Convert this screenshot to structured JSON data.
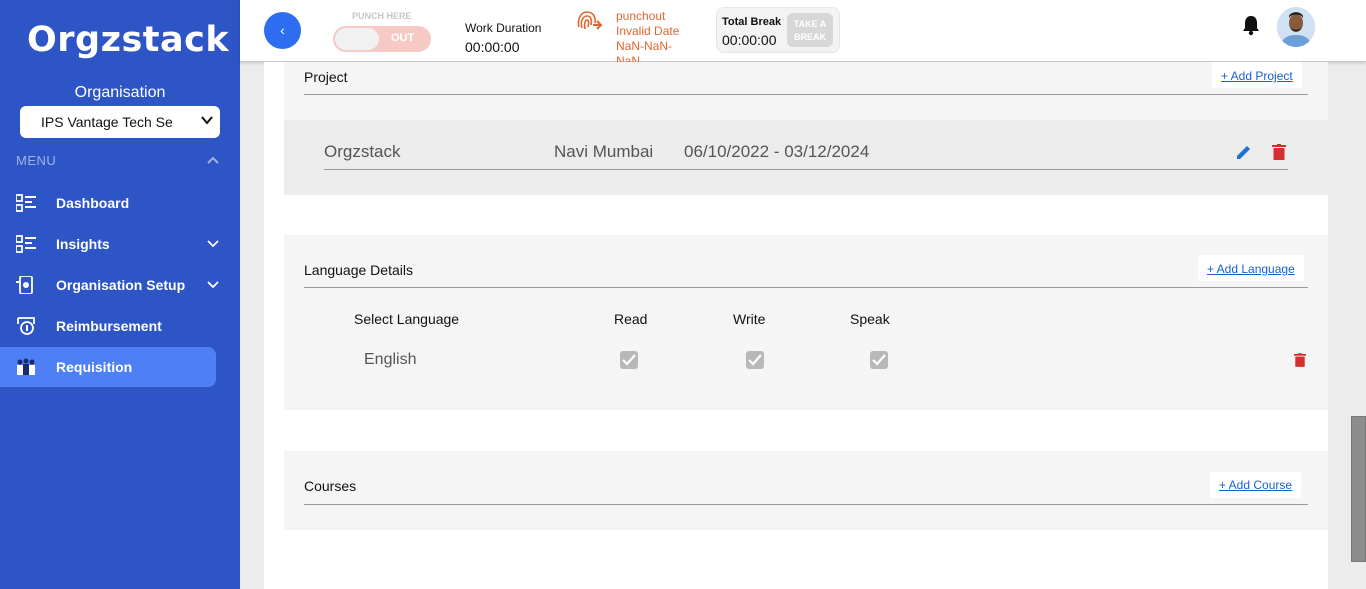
{
  "sidebar": {
    "logo": "Orgzstack",
    "org_label": "Organisation",
    "org_selected": "IPS Vantage Tech Se",
    "menu_label": "MENU",
    "items": [
      {
        "label": "Dashboard"
      },
      {
        "label": "Insights"
      },
      {
        "label": "Organisation Setup"
      },
      {
        "label": "Reimbursement"
      },
      {
        "label": "Requisition"
      }
    ]
  },
  "header": {
    "back_glyph": "‹",
    "punch_label": "PUNCH HERE",
    "punch_state": "OUT",
    "work_duration_label": "Work Duration",
    "work_duration_value": "00:00:00",
    "punchout_lines": [
      "punchout",
      "Invalid Date",
      "NaN-NaN-",
      "NaN"
    ],
    "total_break_label": "Total Break",
    "total_break_value": "00:00:00",
    "take_break_label": "TAKE A BREAK"
  },
  "project": {
    "title": "Project",
    "add_label": "+ Add Project",
    "row": {
      "name": "Orgzstack",
      "location": "Navi Mumbai",
      "dates": "06/10/2022 - 03/12/2024"
    }
  },
  "language": {
    "title": "Language Details",
    "add_label": "+ Add Language",
    "headers": {
      "select": "Select Language",
      "read": "Read",
      "write": "Write",
      "speak": "Speak"
    },
    "row": {
      "language": "English",
      "read": true,
      "write": true,
      "speak": true
    }
  },
  "courses": {
    "title": "Courses",
    "add_label": "+ Add Course"
  },
  "colors": {
    "sidebar_bg": "#2d55c6",
    "active_item": "#4f7ff4",
    "link": "#1a5fd0",
    "delete": "#d32f2f",
    "edit": "#1e6fd9",
    "punch_orange": "#e0662e"
  }
}
